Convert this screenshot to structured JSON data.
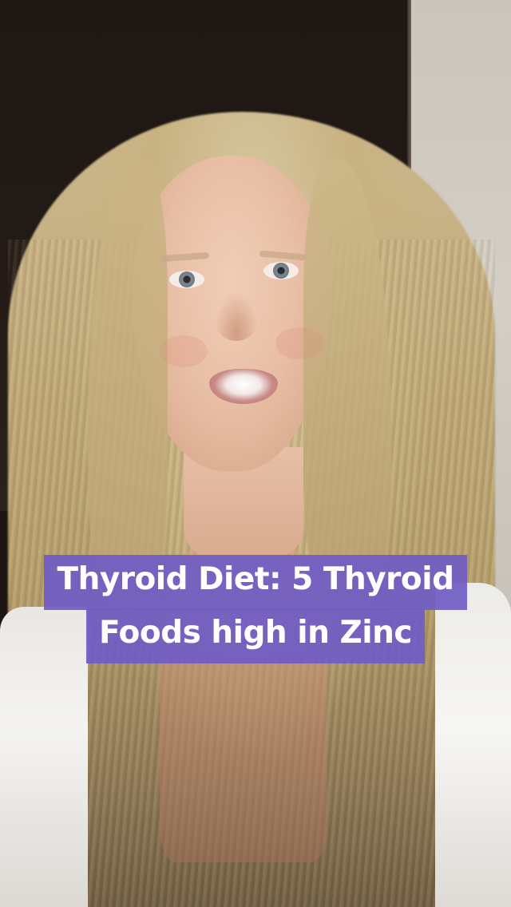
{
  "caption": {
    "line1": "Thyroid Diet: 5 Thyroid",
    "line2": "Foods high in Zinc",
    "background_color": "#705cc4",
    "text_color": "#ffffff"
  },
  "scene": {
    "subject": "video-frame"
  }
}
